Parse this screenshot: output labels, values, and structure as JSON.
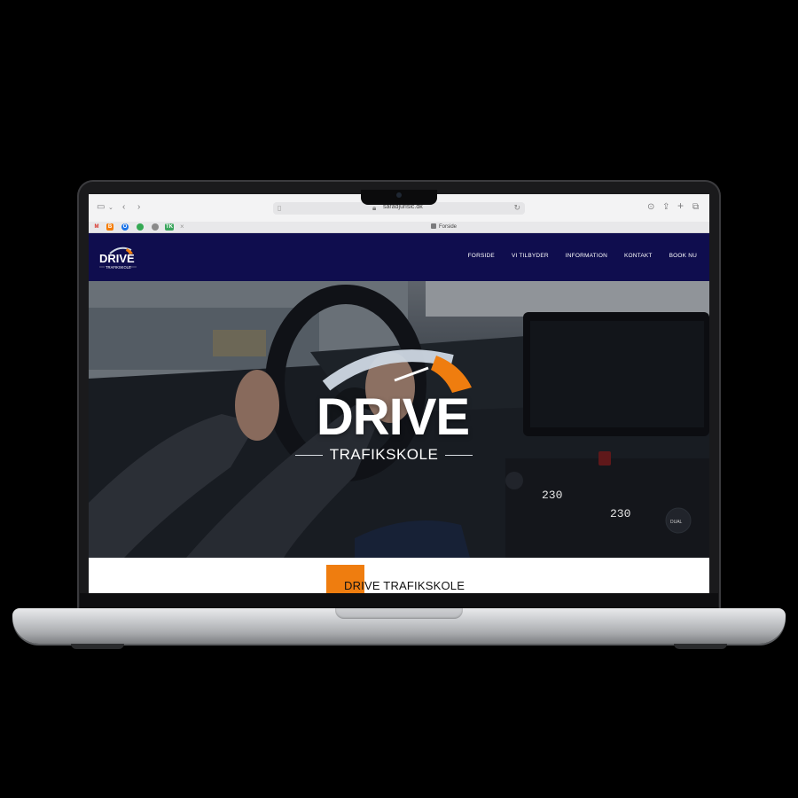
{
  "browser": {
    "url": "saradjurisic.dk",
    "tab_title": "Forside",
    "favicons": [
      {
        "name": "gmail",
        "glyph": "M",
        "color": "#d93025"
      },
      {
        "name": "blogger",
        "glyph": "B",
        "color": "#f57c00"
      },
      {
        "name": "outlook",
        "glyph": "O",
        "color": "#1a73e8"
      },
      {
        "name": "green-app",
        "glyph": "",
        "color": "#34a853"
      },
      {
        "name": "gear",
        "glyph": "",
        "color": "#8a8a8a"
      },
      {
        "name": "tk",
        "glyph": "TK",
        "color": "#3ba55d"
      }
    ]
  },
  "site": {
    "logo_text": "DRIVE",
    "logo_sub": "TRAFIKSKOLE",
    "nav": [
      "FORSIDE",
      "VI TILBYDER",
      "INFORMATION",
      "KONTAKT",
      "BOOK NU"
    ],
    "brand_color": "#0f0d4e",
    "accent_color": "#ef7d0f"
  },
  "hero": {
    "title": "DRIVE",
    "subtitle": "TRAFIKSKOLE",
    "dashboard_display": [
      "230",
      "230"
    ],
    "dial_label": "DUAL"
  },
  "section": {
    "heading": "DRIVE TRAFIKSKOLE"
  }
}
